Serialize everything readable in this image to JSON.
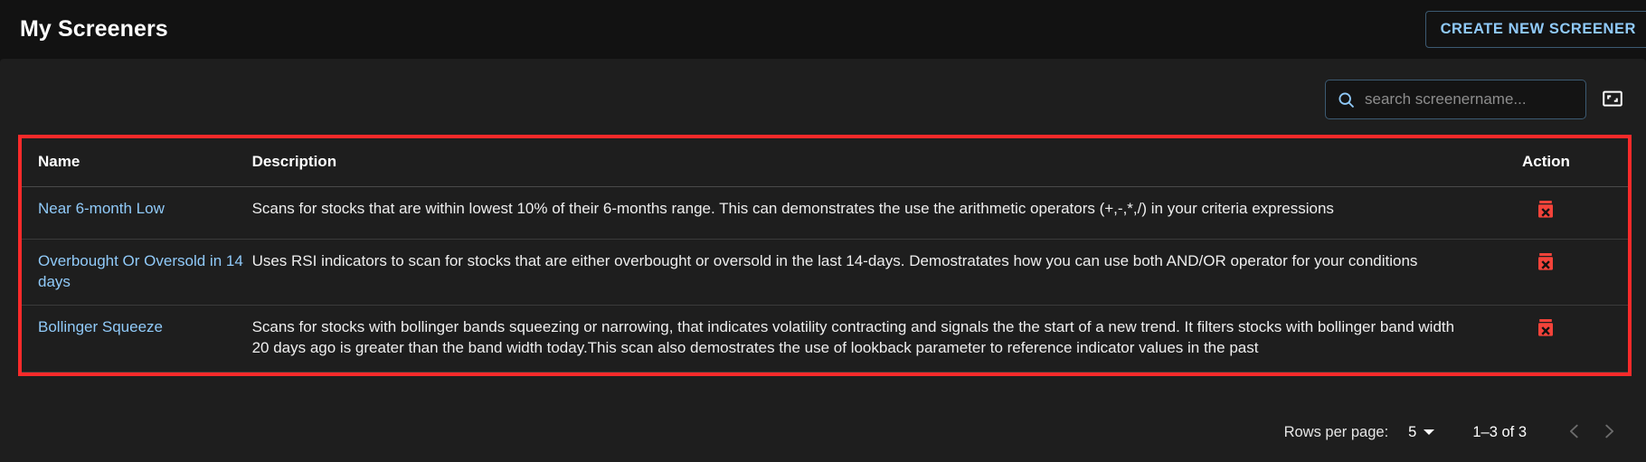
{
  "appbar": {
    "title": "My Screeners",
    "create_button_label": "CREATE NEW SCREENER"
  },
  "toolbar": {
    "search_placeholder": "search screenername...",
    "search_value": "",
    "search_icon": "search-icon",
    "fullscreen_icon": "fullscreen-expand-icon"
  },
  "table": {
    "columns": [
      "Name",
      "Description",
      "Action"
    ],
    "rows": [
      {
        "name": "Near 6-month Low",
        "description": "Scans for stocks that are within lowest 10% of their 6-months range. This can demonstrates the use the arithmetic operators (+,-,*,/) in your criteria expressions",
        "action_icon": "delete-icon"
      },
      {
        "name": "Overbought Or Oversold in 14 days",
        "description": "Uses RSI indicators to scan for stocks that are either overbought or oversold in the last 14-days. Demostratates how you can use both AND/OR operator for your conditions",
        "action_icon": "delete-icon"
      },
      {
        "name": "Bollinger Squeeze",
        "description": "Scans for stocks with bollinger bands squeezing or narrowing, that indicates volatility contracting and signals the the start of a new trend. It filters stocks with bollinger band width 20 days ago is greater than the band width today.This scan also demostrates the use of lookback parameter to reference indicator values in the past",
        "action_icon": "delete-icon"
      }
    ]
  },
  "pagination": {
    "rows_per_page_label": "Rows per page:",
    "rows_per_page_value": "5",
    "range_label": "1–3 of 3",
    "prev_icon": "chevron-left-icon",
    "next_icon": "chevron-right-icon"
  },
  "colors": {
    "accent_link": "#90caf9",
    "highlight_border": "#fb2a2a",
    "delete_icon": "#f4433a",
    "appbar_bg": "#121212",
    "panel_bg": "#1e1e1e"
  }
}
